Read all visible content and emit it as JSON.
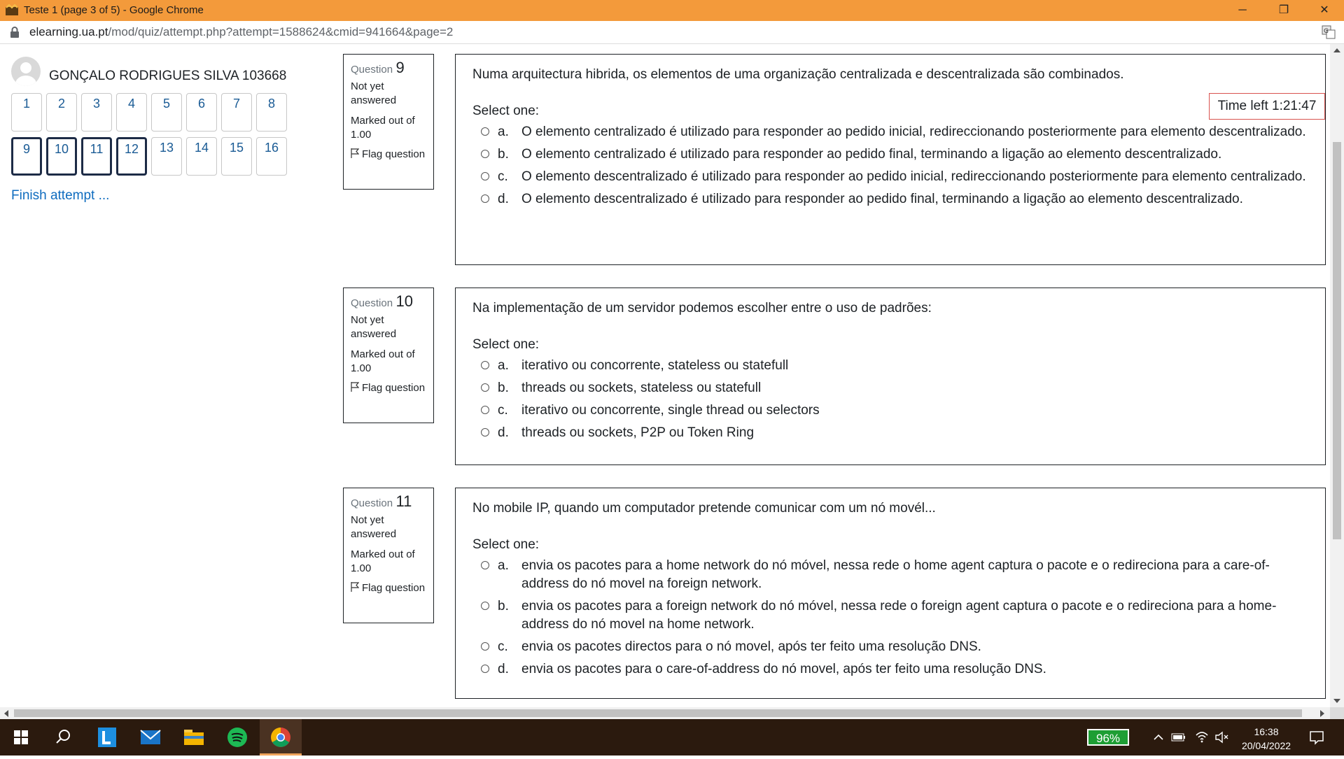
{
  "window": {
    "title": "Teste 1 (page 3 of 5) - Google Chrome",
    "controls": {
      "minimize": "─",
      "maximize": "❐",
      "close": "✕"
    }
  },
  "address": {
    "host": "elearning.ua.pt",
    "path": "/mod/quiz/attempt.php?attempt=1588624&cmid=941664&page=2"
  },
  "sidebar": {
    "user_name": "GONÇALO RODRIGUES SILVA 103668",
    "nav_buttons": [
      "1",
      "2",
      "3",
      "4",
      "5",
      "6",
      "7",
      "8",
      "9",
      "10",
      "11",
      "12",
      "13",
      "14",
      "15",
      "16"
    ],
    "current_page": [
      "9",
      "10",
      "11",
      "12"
    ],
    "finish_label": "Finish attempt ..."
  },
  "timer": {
    "text": "Time left 1:21:47"
  },
  "questions": [
    {
      "label": "Question",
      "number": "9",
      "state": "Not yet answered",
      "marks": "Marked out of 1.00",
      "flag": "Flag question",
      "text": "Numa arquitectura hibrida, os elementos de uma organização centralizada e descentralizada são combinados.",
      "select_label": "Select one:",
      "answers": [
        {
          "letter": "a.",
          "text": "O elemento centralizado é utilizado para responder ao pedido inicial, redireccionando posteriormente para elemento descentralizado."
        },
        {
          "letter": "b.",
          "text": "O elemento centralizado é utilizado para responder ao pedido final, terminando a ligação ao elemento descentralizado."
        },
        {
          "letter": "c.",
          "text": "O elemento descentralizado é utilizado para responder ao pedido inicial, redireccionando posteriormente para elemento centralizado."
        },
        {
          "letter": "d.",
          "text": "O elemento descentralizado é utilizado para responder ao pedido final, terminando a ligação ao elemento descentralizado."
        }
      ]
    },
    {
      "label": "Question",
      "number": "10",
      "state": "Not yet answered",
      "marks": "Marked out of 1.00",
      "flag": "Flag question",
      "text": "Na implementação de um servidor podemos escolher entre o uso de padrões:",
      "select_label": "Select one:",
      "answers": [
        {
          "letter": "a.",
          "text": "iterativo ou concorrente, stateless ou statefull"
        },
        {
          "letter": "b.",
          "text": "threads ou sockets, stateless ou statefull"
        },
        {
          "letter": "c.",
          "text": "iterativo ou concorrente, single thread ou selectors"
        },
        {
          "letter": "d.",
          "text": "threads ou sockets, P2P ou Token Ring"
        }
      ]
    },
    {
      "label": "Question",
      "number": "11",
      "state": "Not yet answered",
      "marks": "Marked out of 1.00",
      "flag": "Flag question",
      "text": "No mobile IP, quando um computador pretende comunicar com um nó movél...",
      "select_label": "Select one:",
      "answers": [
        {
          "letter": "a.",
          "text": "envia os pacotes para a home network do nó móvel, nessa rede o home agent captura o pacote e o redireciona para a care-of-address do nó movel na foreign network."
        },
        {
          "letter": "b.",
          "text": "envia os pacotes para a foreign network do nó móvel, nessa rede o foreign agent captura o pacote e o redireciona para a home-address do nó movel na home network."
        },
        {
          "letter": "c.",
          "text": "envia os pacotes directos para o nó movel, após ter feito uma resolução DNS."
        },
        {
          "letter": "d.",
          "text": "envia os pacotes para o care-of-address do nó movel, após ter feito uma resolução DNS."
        }
      ]
    }
  ],
  "taskbar": {
    "battery": "96%",
    "time": "16:38",
    "date": "20/04/2022",
    "accent": "#f0a45b",
    "apps": [
      "windows-start-icon",
      "search-icon",
      "lexis-app-icon",
      "mail-icon",
      "file-explorer-icon",
      "spotify-icon",
      "chrome-icon"
    ]
  }
}
